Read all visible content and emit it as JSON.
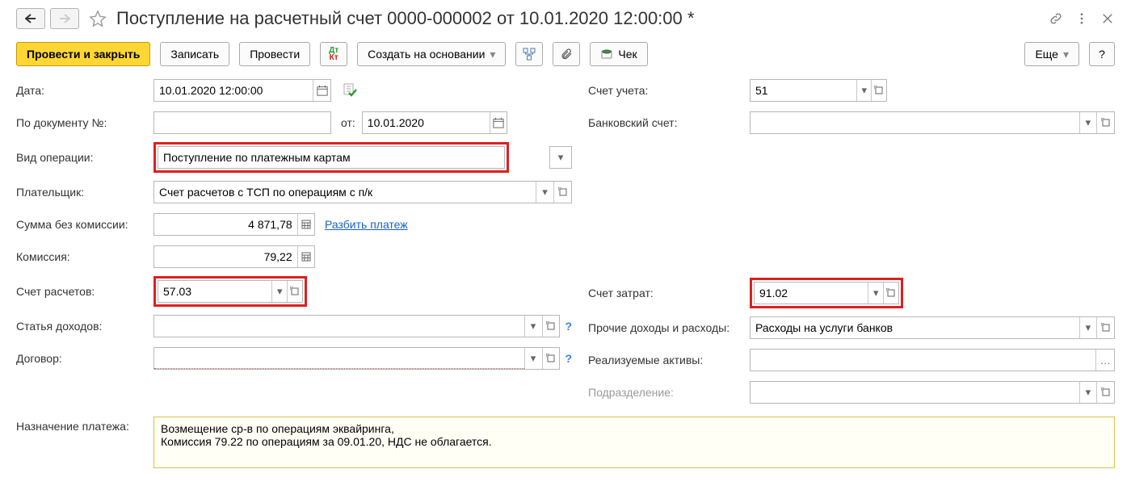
{
  "title": "Поступление на расчетный счет 0000-000002 от 10.01.2020 12:00:00 *",
  "toolbar": {
    "post_close": "Провести и закрыть",
    "write": "Записать",
    "post": "Провести",
    "create_based": "Создать на основании",
    "check": "Чек",
    "more": "Еще",
    "help": "?"
  },
  "left": {
    "date": {
      "label": "Дата:",
      "value": "10.01.2020 12:00:00"
    },
    "doc_num": {
      "label": "По документу №:",
      "value": "",
      "from_label": "от:",
      "from_value": "10.01.2020"
    },
    "op_type": {
      "label": "Вид операции:",
      "value": "Поступление по платежным картам"
    },
    "payer": {
      "label": "Плательщик:",
      "value": "Счет расчетов с ТСП по операциям с п/к"
    },
    "sum": {
      "label": "Сумма без комиссии:",
      "value": "4 871,78",
      "split_link": "Разбить платеж"
    },
    "commission": {
      "label": "Комиссия:",
      "value": "79,22"
    },
    "acc": {
      "label": "Счет расчетов:",
      "value": "57.03"
    },
    "income": {
      "label": "Статья доходов:",
      "value": ""
    },
    "contract": {
      "label": "Договор:",
      "value": ""
    }
  },
  "right": {
    "acct_acc": {
      "label": "Счет учета:",
      "value": "51"
    },
    "bank_acc": {
      "label": "Банковский счет:",
      "value": ""
    },
    "cost_acc": {
      "label": "Счет затрат:",
      "value": "91.02"
    },
    "other": {
      "label": "Прочие доходы и расходы:",
      "value": "Расходы на услуги банков"
    },
    "assets": {
      "label": "Реализуемые активы:",
      "value": ""
    },
    "dept": {
      "label": "Подразделение:",
      "value": ""
    }
  },
  "memo": {
    "label": "Назначение платежа:",
    "value": "Возмещение ср-в по операциям эквайринга,\nКомиссия 79.22 по операциям за 09.01.20, НДС не облагается."
  }
}
